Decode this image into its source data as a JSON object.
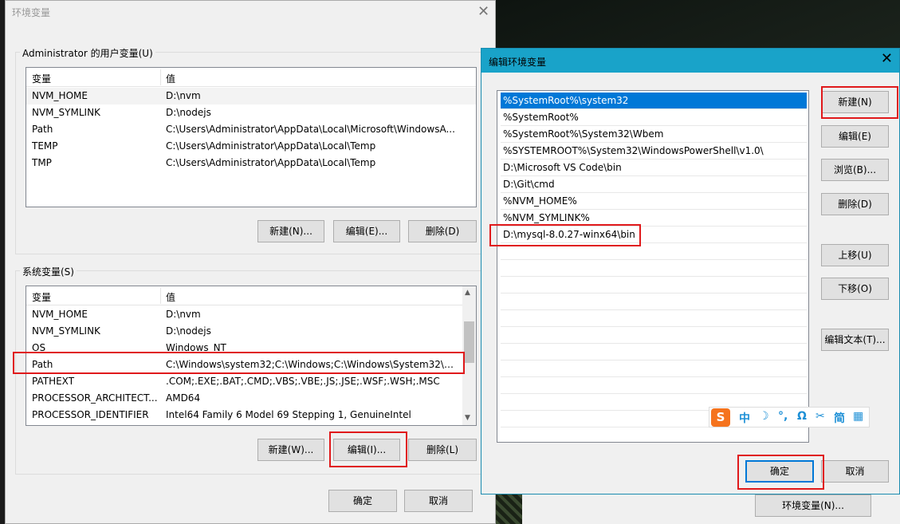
{
  "env_dialog": {
    "title": "环境变量",
    "user_group_label": "Administrator 的用户变量(U)",
    "system_group_label": "系统变量(S)",
    "col_var": "变量",
    "col_val": "值",
    "user_vars": [
      {
        "name": "NVM_HOME",
        "value": "D:\\nvm"
      },
      {
        "name": "NVM_SYMLINK",
        "value": "D:\\nodejs"
      },
      {
        "name": "Path",
        "value": "C:\\Users\\Administrator\\AppData\\Local\\Microsoft\\WindowsA..."
      },
      {
        "name": "TEMP",
        "value": "C:\\Users\\Administrator\\AppData\\Local\\Temp"
      },
      {
        "name": "TMP",
        "value": "C:\\Users\\Administrator\\AppData\\Local\\Temp"
      }
    ],
    "system_vars": [
      {
        "name": "NVM_HOME",
        "value": "D:\\nvm"
      },
      {
        "name": "NVM_SYMLINK",
        "value": "D:\\nodejs"
      },
      {
        "name": "OS",
        "value": "Windows_NT"
      },
      {
        "name": "Path",
        "value": "C:\\Windows\\system32;C:\\Windows;C:\\Windows\\System32\\Wb..."
      },
      {
        "name": "PATHEXT",
        "value": ".COM;.EXE;.BAT;.CMD;.VBS;.VBE;.JS;.JSE;.WSF;.WSH;.MSC"
      },
      {
        "name": "PROCESSOR_ARCHITECT...",
        "value": "AMD64"
      },
      {
        "name": "PROCESSOR_IDENTIFIER",
        "value": "Intel64 Family 6 Model 69 Stepping 1, GenuineIntel"
      }
    ],
    "user_buttons": {
      "new": "新建(N)...",
      "edit": "编辑(E)...",
      "delete": "删除(D)"
    },
    "system_buttons": {
      "new": "新建(W)...",
      "edit": "编辑(I)...",
      "delete": "删除(L)"
    },
    "ok": "确定",
    "cancel": "取消"
  },
  "edit_dialog": {
    "title": "编辑环境变量",
    "paths": [
      "%SystemRoot%\\system32",
      "%SystemRoot%",
      "%SystemRoot%\\System32\\Wbem",
      "%SYSTEMROOT%\\System32\\WindowsPowerShell\\v1.0\\",
      "D:\\Microsoft VS Code\\bin",
      "D:\\Git\\cmd",
      "%NVM_HOME%",
      "%NVM_SYMLINK%",
      "D:\\mysql-8.0.27-winx64\\bin"
    ],
    "buttons": {
      "new": "新建(N)",
      "edit": "编辑(E)",
      "browse": "浏览(B)...",
      "delete": "删除(D)",
      "move_up": "上移(U)",
      "move_down": "下移(O)",
      "edit_text": "编辑文本(T)..."
    },
    "ok": "确定",
    "cancel": "取消"
  },
  "ime_bar": {
    "logo": "S",
    "items": [
      "中",
      "☽",
      "°,",
      "Ω",
      "✂",
      "简",
      "▦"
    ]
  },
  "background_button": "环境变量(N)...",
  "colors": {
    "selection": "#0078d7",
    "titlebar": "#19a3c9",
    "highlight_box": "#e0191b",
    "ime_logo": "#f5731d",
    "ime_icon": "#1e90d6"
  }
}
